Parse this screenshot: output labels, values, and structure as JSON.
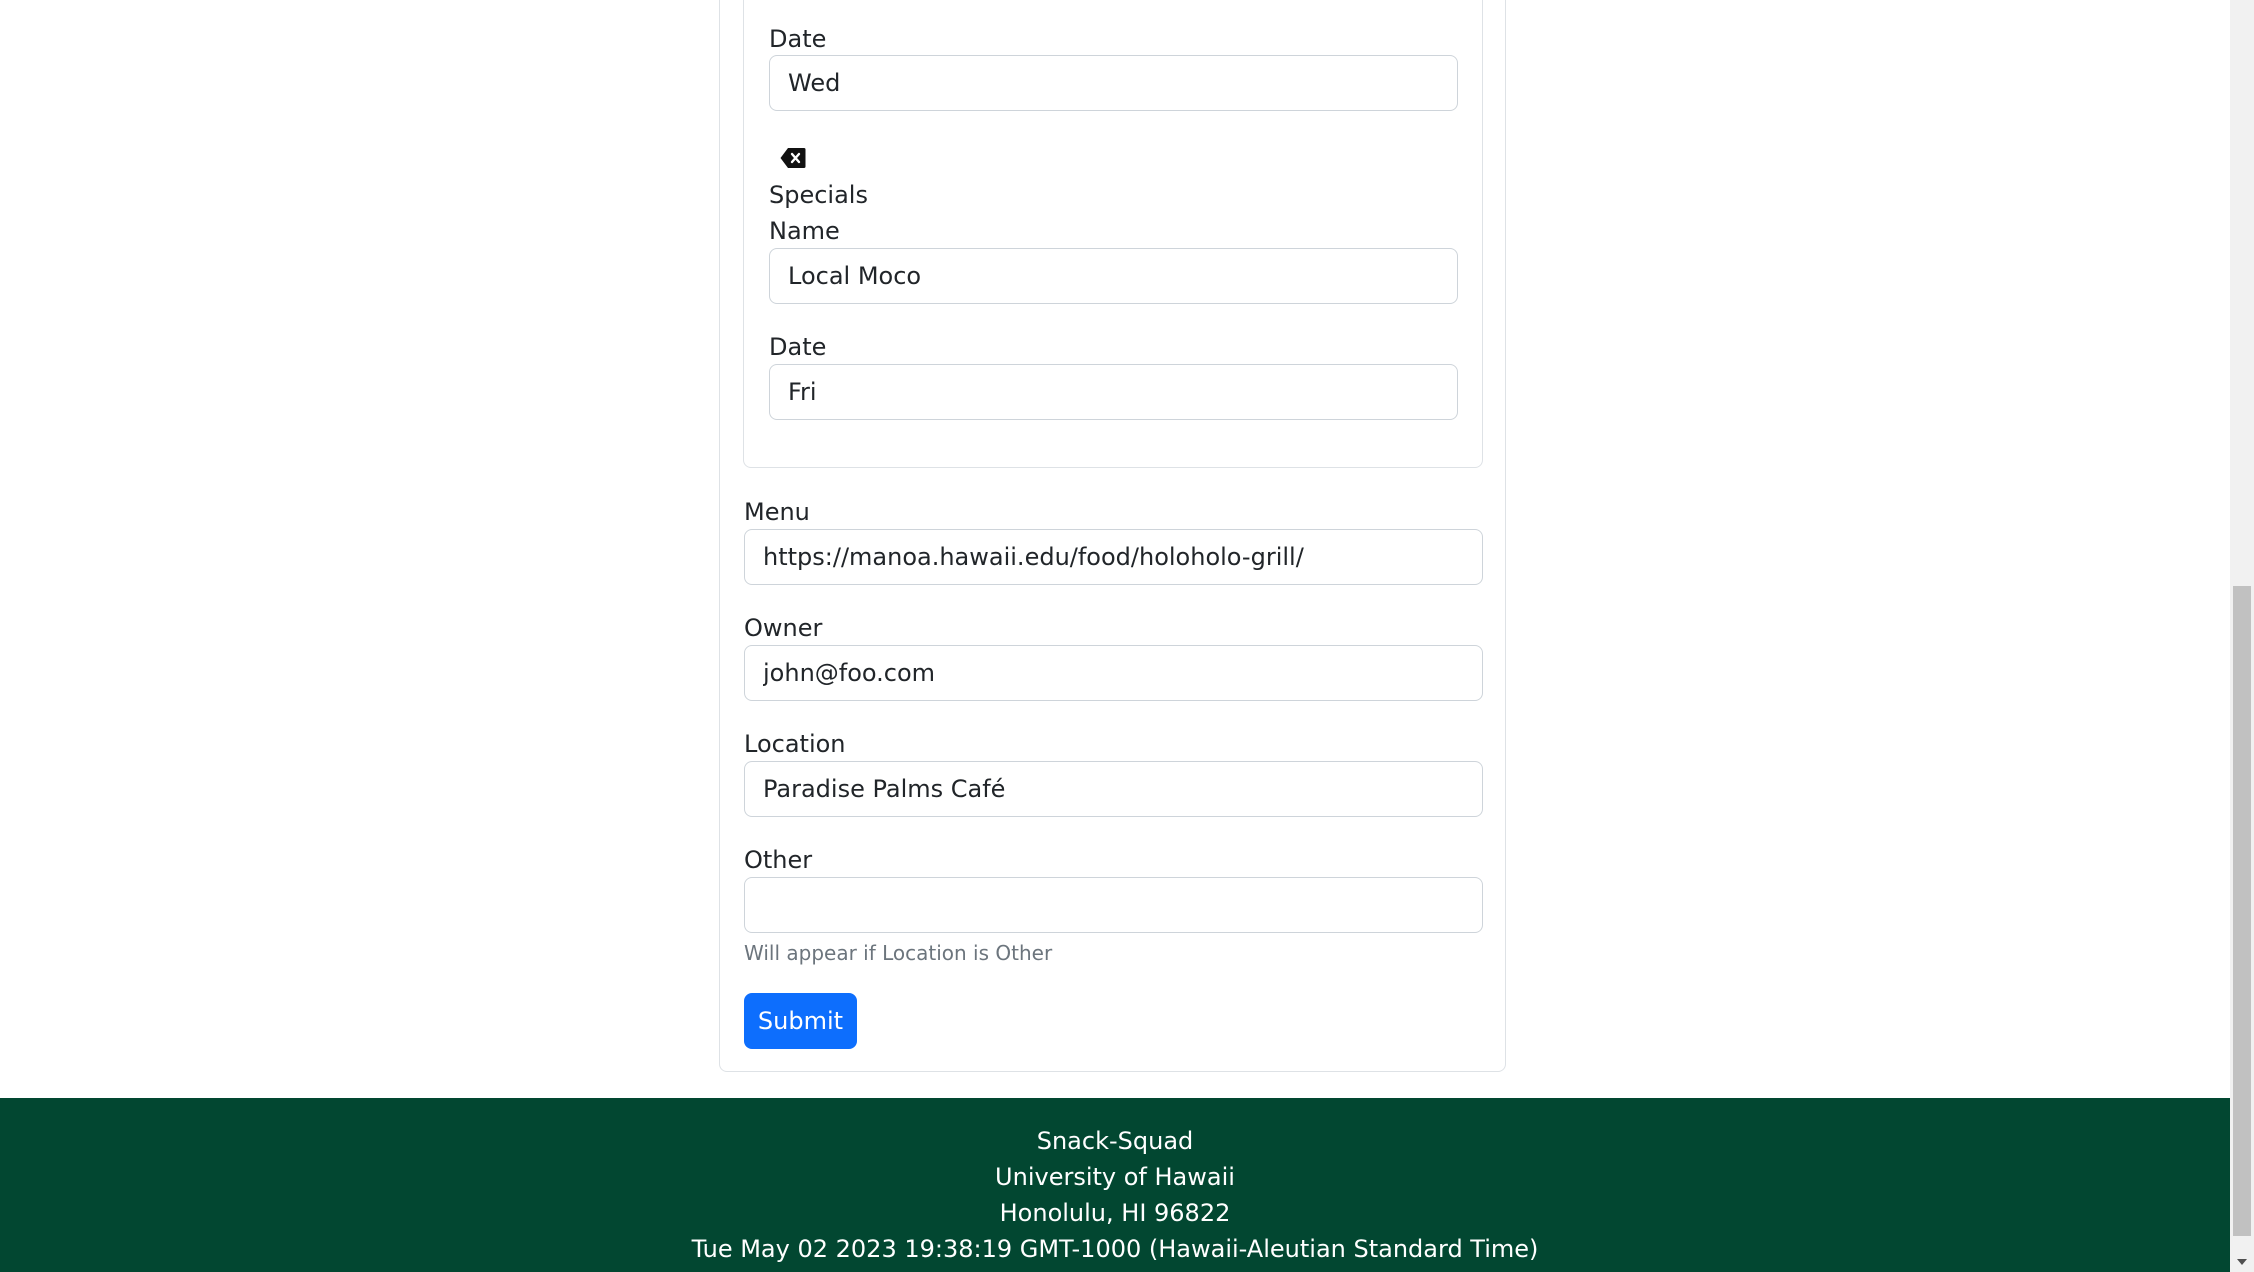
{
  "specials_section": {
    "item1": {
      "date_label": "Date",
      "date_value": "Wed"
    },
    "delete_icon": "backspace-x-icon",
    "section_label": "Specials",
    "item2": {
      "name_label": "Name",
      "name_value": "Local Moco",
      "date_label": "Date",
      "date_value": "Fri"
    }
  },
  "form": {
    "menu_label": "Menu",
    "menu_value": "https://manoa.hawaii.edu/food/holoholo-grill/",
    "owner_label": "Owner",
    "owner_value": "john@foo.com",
    "location_label": "Location",
    "location_value": "Paradise Palms Café",
    "other_label": "Other",
    "other_value": "",
    "other_help": "Will appear if Location is Other",
    "submit_label": "Submit"
  },
  "footer": {
    "line1": "Snack-Squad",
    "line2": "University of Hawaii",
    "line3": "Honolulu, HI 96822",
    "line4": "Tue May 02 2023 19:38:19 GMT-1000 (Hawaii-Aleutian Standard Time)"
  },
  "colors": {
    "footer_bg": "#024731",
    "submit_bg": "#0d6efd"
  }
}
